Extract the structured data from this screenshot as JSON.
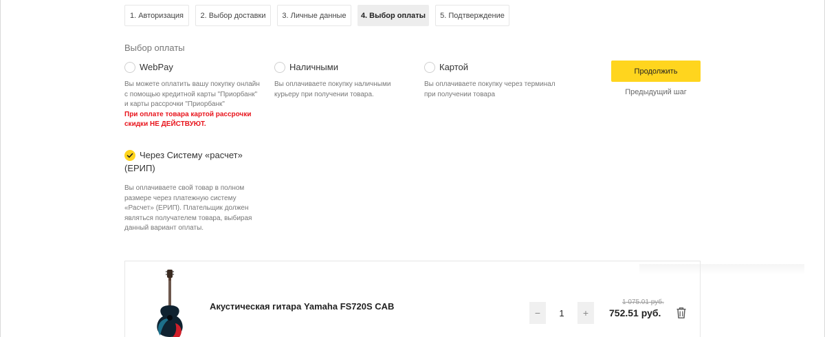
{
  "steps": [
    {
      "label": "1. Авторизация"
    },
    {
      "label": "2. Выбор доставки"
    },
    {
      "label": "3. Личные данные"
    },
    {
      "label": "4. Выбор оплаты"
    },
    {
      "label": "5. Подтверждение"
    }
  ],
  "active_step": "4. Выбор оплаты",
  "payment": {
    "title": "Выбор оплаты",
    "options": [
      {
        "label": "WebPay",
        "selected": false,
        "desc_lines": [
          "Вы можете оплатить вашу покупку онлайн",
          "с помощью кредитной карты \"Приорбанк\"",
          "и карты рассрочки \"Приорбанк\""
        ],
        "warning_lines": [
          "При оплате товара картой рассрочки",
          "скидки НЕ ДЕЙСТВУЮТ."
        ]
      },
      {
        "label": "Наличными",
        "selected": false,
        "desc_lines": [
          "Вы оплачиваете покупку наличными",
          "курьеру при получении товара."
        ]
      },
      {
        "label": "Картой",
        "selected": false,
        "desc_lines": [
          "Вы оплачиваете покупку через терминал",
          "при получении товара"
        ]
      },
      {
        "label_lines": [
          "Через Систему «расчет»",
          "(ЕРИП)"
        ],
        "selected": true,
        "desc_lines": [
          "Вы оплачиваете свой товар в полном",
          "размере через платежную систему",
          "«Расчет» (ЕРИП). Плательщик должен",
          "являться получателем товара, выбирая",
          "данный вариант оплаты."
        ]
      }
    ]
  },
  "actions": {
    "continue_label": "Продолжить",
    "prev_label": "Предыдущий шаг"
  },
  "cart": {
    "item": {
      "name": "Акустическая гитара Yamaha FS720S CAB",
      "quantity": "1",
      "old_price": "1 075.01 руб.",
      "price": "752.51 руб.",
      "minus": "−",
      "plus": "+"
    }
  },
  "icons": {
    "check": "check-icon",
    "trash": "trash-icon",
    "product": "guitar-image"
  },
  "colors": {
    "accent": "#ffd51e",
    "warning": "#e8141c"
  }
}
